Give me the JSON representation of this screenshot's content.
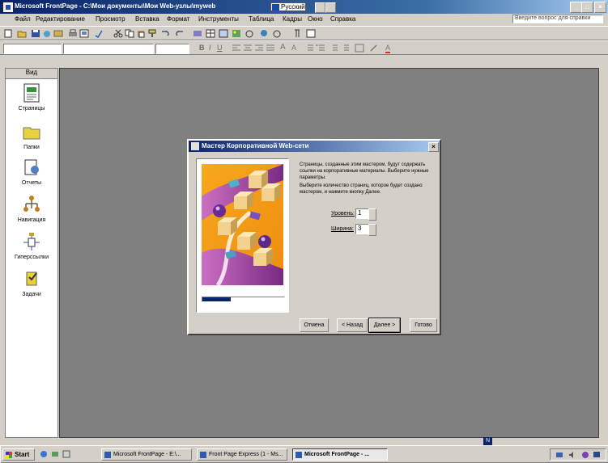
{
  "window": {
    "title": "Microsoft FrontPage - C:\\Мои документы\\Мои Web-узлы\\myweb",
    "language": "Русский",
    "controls": [
      "_",
      "□",
      "×"
    ]
  },
  "menu": {
    "items": [
      "Файл",
      "Редактирование",
      "Просмотр",
      "Вставка",
      "Формат",
      "Инструменты",
      "Таблица",
      "Кадры",
      "Окно",
      "Справка"
    ],
    "help_placeholder": "Введите вопрос для справки"
  },
  "views": {
    "header": "Вид",
    "items": [
      {
        "label": "Страницы",
        "icon": "page-icon"
      },
      {
        "label": "Папки",
        "icon": "folder-icon"
      },
      {
        "label": "Отчеты",
        "icon": "reports-icon"
      },
      {
        "label": "Навигация",
        "icon": "navigation-icon"
      },
      {
        "label": "Гиперссылки",
        "icon": "hyperlinks-icon"
      },
      {
        "label": "Задачи",
        "icon": "tasks-icon"
      }
    ]
  },
  "dialog": {
    "title": "Мастер Корпоративной Web-сети",
    "description_1": "Страницы, созданные этим мастером, будут содержать ссылки на корпоративные материалы. Выберите нужные параметры.",
    "description_2": "Выберите количество страниц, которое будет создано мастером, и нажмите кнопку Далее.",
    "field1_label": "Уровень:",
    "field1_value": "1",
    "field2_label": "Ширина:",
    "field2_value": "3",
    "progress": 0.35,
    "buttons": {
      "cancel": "Отмена",
      "back": "< Назад",
      "next": "Далее >",
      "finish": "Готово"
    }
  },
  "statusbar": {
    "badge": "N"
  },
  "taskbar": {
    "start": "Start",
    "tasks": [
      {
        "label": "Microsoft FrontPage - E:\\..."
      },
      {
        "label": "Front Page Express (1 - Ms..."
      },
      {
        "label": "Microsoft FrontPage - ..."
      }
    ]
  },
  "colors": {
    "title_blue": "#0a246a",
    "workspace_gray": "#808080",
    "art_orange": "#f5a020",
    "art_purple": "#7a2c9c"
  }
}
